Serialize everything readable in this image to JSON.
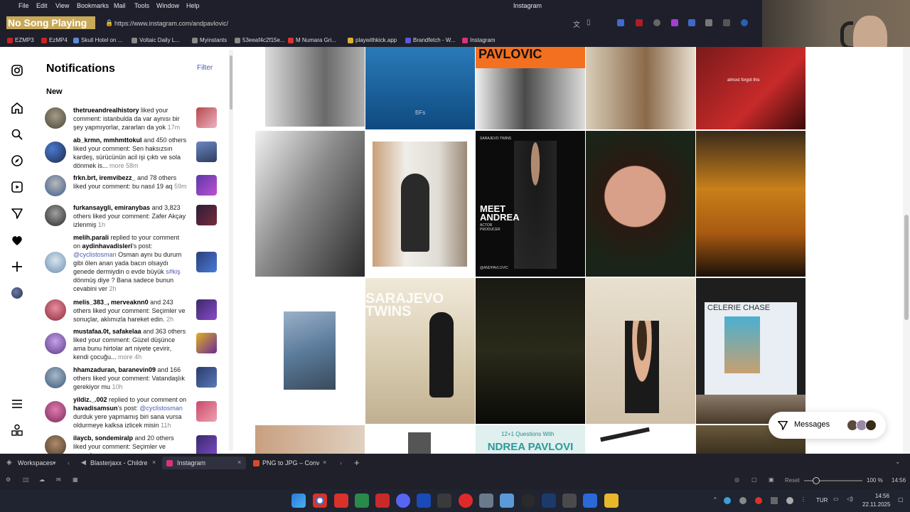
{
  "menu": [
    "File",
    "Edit",
    "View",
    "Bookmarks",
    "Mail",
    "Tools",
    "Window",
    "Help"
  ],
  "window_title": "Instagram",
  "overlay": {
    "now_playing": "No Song Playing"
  },
  "address": {
    "url": "https://www.instagram.com/andpavlovic/"
  },
  "bookmarks": [
    "EZMP3",
    "EzMP4",
    "Skull Hotel on ...",
    "Voltaic Daily L...",
    "Myinstants",
    "53eeaf4c2f15e...",
    "M Numara Gri...",
    "playwithkick.app",
    "Brandfetch - W...",
    "Instagram"
  ],
  "notifications": {
    "title": "Notifications",
    "filter": "Filter",
    "section_new": "New",
    "items": [
      {
        "user": "thetrueandrealhistory",
        "text": " liked your comment: istanbulda da var aynısı bir şey yapmıyorlar, zararları da yok ",
        "time": "17m"
      },
      {
        "user": "ab_krmn, mmhmttokul",
        "text": " and 450 others liked your comment: Sen haksızsın kardeş, sürücünün acil işi çıktı ve sola dönmek is... ",
        "more": "more",
        "time": "58m"
      },
      {
        "user": "frkn.brt, iremvibezz_",
        "text": " and 78 others liked your comment: bu nasıl 19 aq ",
        "time": "59m"
      },
      {
        "user": "furkansaygli, emiranybas",
        "text": " and 3,823 others liked your comment: Zafer Akçay izlenmiş ",
        "time": "1h"
      },
      {
        "user": "melih.parali",
        "text": " replied to your comment on ",
        "user2": "aydinhavadisleri",
        "text2": "'s post: ",
        "mention": "@cyclistosman",
        "text3": " Osman aynı bu durum gibi ölen anan yada bacın olsaydı genede dermiydin o evde büyük ",
        "hashtag": "s#kiş",
        "text4": " dönmüş diye ? Bana sadece bunun cevabini ver ",
        "time": "2h"
      },
      {
        "user": "melis_383_, merveaknn0",
        "text": " and 243 others liked your comment: Seçimler ve sonuçlar, aklımızla hareket edin. ",
        "time": "2h"
      },
      {
        "user": "mustafaa.0t, safakelaa",
        "text": " and 363 others liked your comment: Güzel düşünce ama bunu hirtolar art niyete çevirir, kendi çocuğu... ",
        "more": "more",
        "time": "4h"
      },
      {
        "user": "hhamzaduran, baranevin09",
        "text": " and 166 others liked your comment: Vatandaşlık gerekiyor mu ",
        "time": "10h"
      },
      {
        "user": "yildiz._.002",
        "text": " replied to your comment on ",
        "user2": "havadisamsun",
        "text2": "'s post: ",
        "mention": "@cyclistosman",
        "text3": " durduk yere yapmamış biri sana vursa oldurmeye kalksa izlicek misin ",
        "time": "11h"
      },
      {
        "user": "ilaycb, sondemiralp",
        "text": " and 20 others liked your comment: Seçimler ve sonuçlar",
        "time": ""
      }
    ]
  },
  "grid": {
    "tile_texts": {
      "pavlovic": "PAVLOVIC",
      "sarajevo_small": "SARAJEVO TWINS",
      "meet": "MEET ANDREA",
      "actor": "ACTOR PRODUCER",
      "handle": "@ANDPAVLOVIC",
      "sarajevo_big": "SARAJEVO TWINS",
      "celerie": "CELERIE CHASE",
      "questions": "12+1 Questions With",
      "andrea_pav": "NDREA PAVLOVI",
      "almost": "almost forgot this",
      "bfs": "BFs"
    }
  },
  "messages": {
    "label": "Messages"
  },
  "browser_tabs": {
    "workspaces": "Workspaces",
    "tabs": [
      "Blasterjaxx - Children O",
      "Instagram",
      "PNG to JPG – Convert"
    ]
  },
  "statusbar": {
    "reset": "Reset",
    "zoom": "100 %",
    "time": "14:56"
  },
  "taskbar": {
    "lang": "TUR",
    "time": "14:56",
    "date": "22.11.2025"
  },
  "colors": {
    "bg_dark": "#1e1f2b",
    "ig_link": "#4a5db8",
    "taskbar": "#202330"
  }
}
